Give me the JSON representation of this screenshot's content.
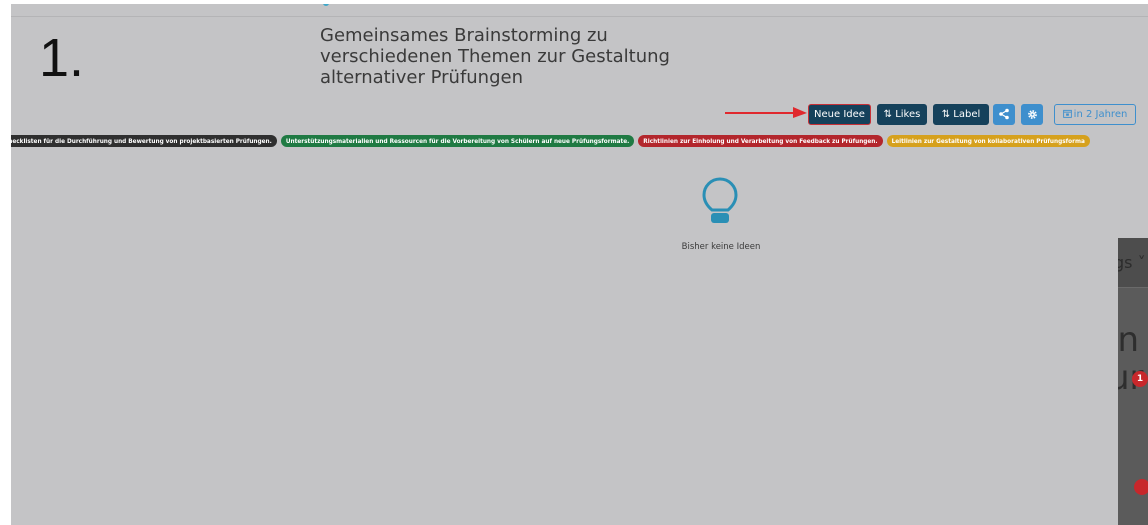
{
  "step": "1.",
  "board": {
    "title": "Gemeinsames Brainstorming zu verschiedenen Themen zur Gestaltung alternativer Prüfungen"
  },
  "toolbar": {
    "new_idea": "Neue Idee",
    "likes": "⇅ Likes",
    "label": "⇅ Label",
    "share_icon": "share-icon",
    "settings_icon": "gear-icon",
    "deadline": "in 2 Jahren"
  },
  "labels": [
    {
      "text": "Checklisten für die Durchführung und Bewertung von projektbasierten Prüfungen.",
      "color": "#2f2f2f"
    },
    {
      "text": "Unterstützungsmaterialien und Ressourcen für die Vorbereitung von Schülern auf neue Prüfungsformate.",
      "color": "#1f7a43"
    },
    {
      "text": "Richtlinien zur Einholung und Verarbeitung von Feedback zu Prüfungen.",
      "color": "#b3262c"
    },
    {
      "text": "Leitlinien zur Gestaltung von kollaborativen Prüfungsforma",
      "color": "#d6a11d"
    }
  ],
  "empty_state": {
    "icon": "lightbulb-icon",
    "text": "Bisher keine Ideen"
  },
  "overlay": {
    "tab_fragment": "gs ˅",
    "line1": "in",
    "line2": "ur",
    "badge1": "1",
    "badge2": ""
  },
  "colors": {
    "primary": "#15415b",
    "accent": "#3e8fcd",
    "annotation": "#e0282d"
  }
}
